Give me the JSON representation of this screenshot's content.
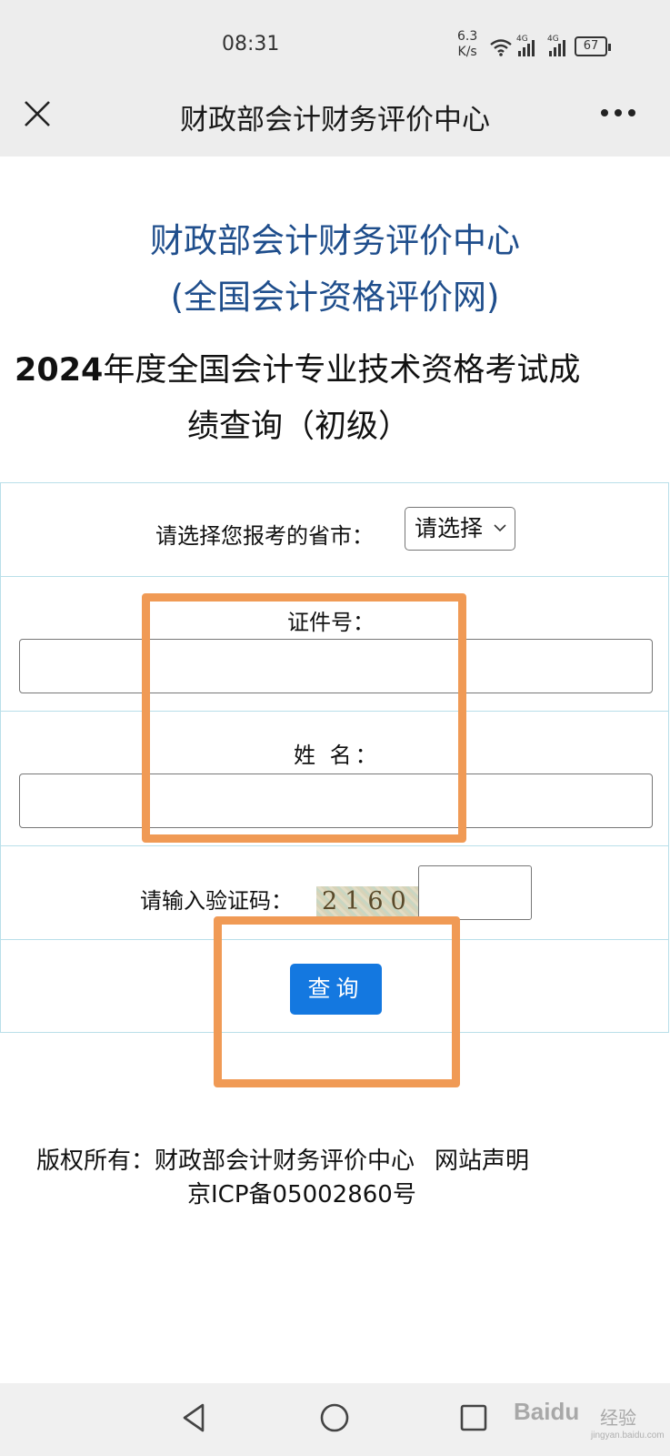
{
  "status_bar": {
    "time": "08:31",
    "net_speed_value": "6.3",
    "net_speed_unit": "K/s",
    "signal_1_tag": "4G",
    "signal_2_tag": "4G",
    "battery": "67",
    "icons": [
      "wifi-icon",
      "signal-icon",
      "signal-icon",
      "battery-icon"
    ]
  },
  "nav": {
    "title": "财政部会计财务评价中心",
    "close_icon": "close-icon",
    "more_icon": "more-icon"
  },
  "header": {
    "site_name": "财政部会计财务评价中心",
    "site_sub": "(全国会计资格评价网)",
    "title_year": "2024",
    "title_line1_rest": "年度全国会计专业技术资格考试成",
    "title_line2": "绩查询（初级）"
  },
  "form": {
    "province_label": "请选择您报考的省市：",
    "province_selected": "请选择",
    "id_label": "证件号：",
    "id_value": "",
    "name_label": "姓 名：",
    "name_value": "",
    "captcha_label": "请输入验证码：",
    "captcha_text": "2160",
    "captcha_value": "",
    "submit_label": "查询"
  },
  "footer": {
    "copyright": "版权所有：财政部会计财务评价中心",
    "statement_link": "网站声明",
    "icp": "京ICP备05002860号"
  },
  "watermark": {
    "brand": "Baidu",
    "brand_cn": "经验",
    "domain": "jingyan.baidu.com"
  },
  "colors": {
    "title_blue": "#1f4e8c",
    "button_blue": "#1478e0",
    "annotation_orange": "#f09a55",
    "table_border": "#b9dfe9"
  }
}
